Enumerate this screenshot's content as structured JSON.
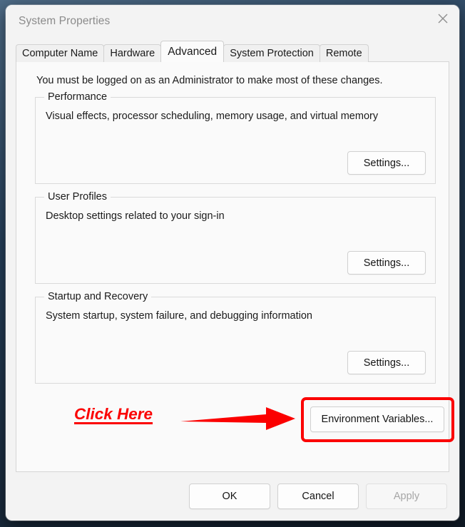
{
  "window": {
    "title": "System Properties",
    "close_icon": "close-icon"
  },
  "tabs": [
    {
      "label": "Computer Name",
      "selected": false
    },
    {
      "label": "Hardware",
      "selected": false
    },
    {
      "label": "Advanced",
      "selected": true
    },
    {
      "label": "System Protection",
      "selected": false
    },
    {
      "label": "Remote",
      "selected": false
    }
  ],
  "content": {
    "admin_note": "You must be logged on as an Administrator to make most of these changes.",
    "groups": [
      {
        "legend": "Performance",
        "description": "Visual effects, processor scheduling, memory usage, and virtual memory",
        "button": "Settings..."
      },
      {
        "legend": "User Profiles",
        "description": "Desktop settings related to your sign-in",
        "button": "Settings..."
      },
      {
        "legend": "Startup and Recovery",
        "description": "System startup, system failure, and debugging information",
        "button": "Settings..."
      }
    ],
    "environment": {
      "button": "Environment Variables...",
      "annotation_text": "Click Here",
      "annotation_color": "#fb0000",
      "highlight_color": "#fb0000",
      "arrow_icon": "right-arrow-icon"
    }
  },
  "actions": {
    "ok": "OK",
    "cancel": "Cancel",
    "apply": "Apply"
  }
}
